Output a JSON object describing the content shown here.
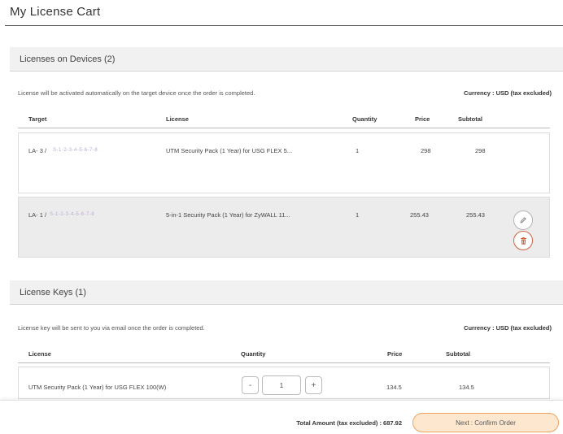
{
  "page": {
    "title": "My License Cart"
  },
  "devices_section": {
    "title": "Licenses on Devices (2)",
    "note": "License will be activated automatically on the target device once the order is completed.",
    "currency": "Currency : USD  (tax excluded)",
    "columns": {
      "target": "Target",
      "license": "License",
      "quantity": "Quantity",
      "price": "Price",
      "subtotal": "Subtotal"
    },
    "rows": [
      {
        "target": "LA- 3 / ",
        "target_obscured": "S-1-2-3-4-5-6-7-8",
        "license": "UTM Security Pack (1 Year) for USG FLEX 5...",
        "quantity": "1",
        "price": "298",
        "subtotal": "298"
      },
      {
        "target": "LA- 1 / ",
        "target_obscured": "S-1-2-3-4-5-6-7-8",
        "license": "5-in-1 Security Pack (1 Year) for ZyWALL 11...",
        "quantity": "1",
        "price": "255.43",
        "subtotal": "255.43"
      }
    ]
  },
  "keys_section": {
    "title": "License Keys (1)",
    "note": "License key will be sent to you via email once the order is completed.",
    "currency": "Currency : USD  (tax excluded)",
    "columns": {
      "license": "License",
      "quantity": "Quantity",
      "price": "Price",
      "subtotal": "Subtotal"
    },
    "rows": [
      {
        "license": "UTM Security Pack (1 Year) for USG FLEX 100(W)",
        "decrement": "-",
        "quantity": "1",
        "increment": "+",
        "price": "134.5",
        "subtotal": "134.5"
      }
    ]
  },
  "footer": {
    "total": "Total Amount (tax excluded) : 687.92",
    "next_button": "Next : Confirm Order"
  },
  "icons": {
    "edit": "pencil-icon",
    "delete": "trash-icon"
  },
  "colors": {
    "accent": "#f0a25f",
    "accent_bg": "#fde8cf",
    "delete": "#d0623f"
  }
}
